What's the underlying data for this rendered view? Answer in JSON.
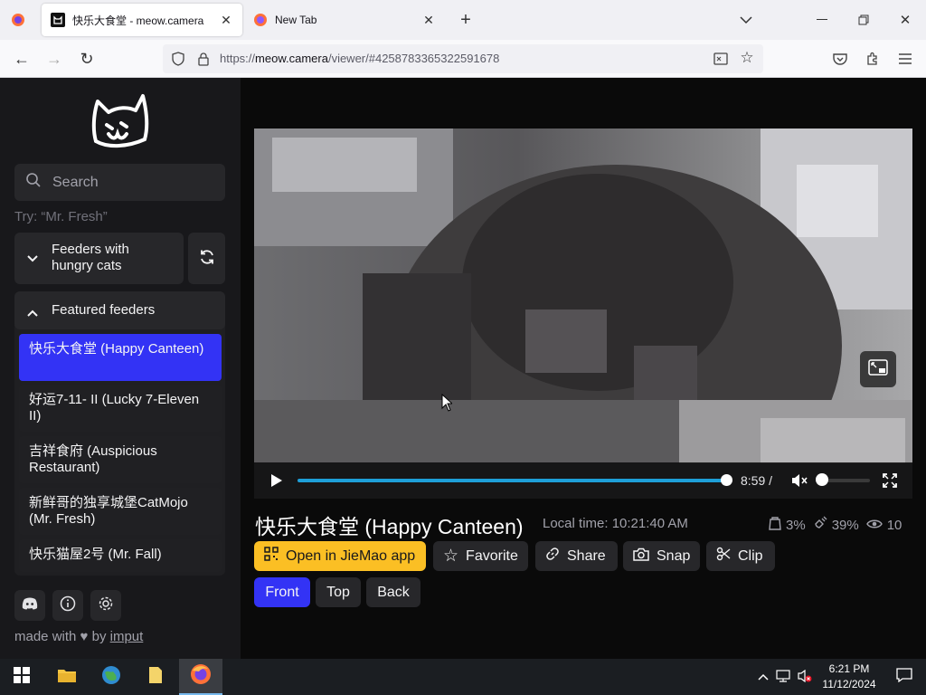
{
  "browser": {
    "tabs": [
      {
        "title": "快乐大食堂 - meow.camera",
        "active": true
      },
      {
        "title": "New Tab",
        "active": false
      }
    ],
    "url_prefix": "https://",
    "url_host": "meow.camera",
    "url_path": "/viewer/#4258783365322591678"
  },
  "sidebar": {
    "search_placeholder": "Search",
    "hint": "Try: “Mr. Fresh”",
    "hungry_section": "Feeders with hungry cats",
    "featured_section": "Featured feeders",
    "feeders": [
      {
        "label": "快乐大食堂 (Happy Canteen)",
        "selected": true
      },
      {
        "label": "好运7-11- II (Lucky 7-Eleven II)",
        "selected": false
      },
      {
        "label": "吉祥食府 (Auspicious Restaurant)",
        "selected": false
      },
      {
        "label": "新鲜哥的独享城堡CatMojo (Mr. Fresh)",
        "selected": false
      },
      {
        "label": "快乐猫屋2号 (Mr. Fall)",
        "selected": false
      }
    ],
    "made_with": "made with",
    "by": "by",
    "author": "imput"
  },
  "player": {
    "time": "8:59 /",
    "progress": 0.99,
    "volume": 0.0
  },
  "camera": {
    "title": "快乐大食堂 (Happy Canteen)",
    "local_time": "Local time: 10:21:40 AM",
    "stats": {
      "food": "3%",
      "battery": "39%",
      "viewers": "10"
    },
    "actions": {
      "open_app": "Open in JieMao app",
      "favorite": "Favorite",
      "share": "Share",
      "snap": "Snap",
      "clip": "Clip"
    },
    "views": [
      {
        "label": "Front",
        "active": true
      },
      {
        "label": "Top",
        "active": false
      },
      {
        "label": "Back",
        "active": false
      }
    ]
  },
  "taskbar": {
    "time": "6:21 PM",
    "date": "11/12/2024"
  },
  "colors": {
    "accent_blue": "#3333f5",
    "primary_yellow": "#fbbf24",
    "progress_blue": "#1e9fd8"
  }
}
